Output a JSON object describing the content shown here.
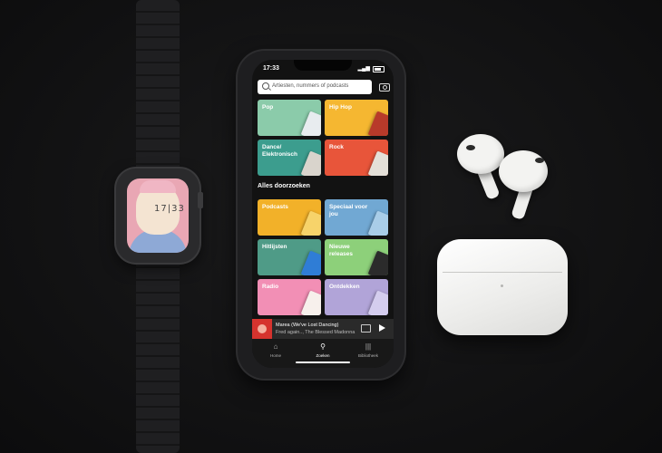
{
  "watch": {
    "time": "17|33"
  },
  "phone": {
    "status": {
      "time": "17:33"
    },
    "search": {
      "placeholder": "Artiesten, nummers of podcasts"
    },
    "top_genres": [
      {
        "label": "Pop",
        "color": "#8bcbaa"
      },
      {
        "label": "Hip Hop",
        "color": "#f5b731"
      },
      {
        "label": "Dance/ Elektronisch",
        "color": "#3c9d8e"
      },
      {
        "label": "Rock",
        "color": "#e8553a"
      }
    ],
    "section_heading": "Alles doorzoeken",
    "browse_all": [
      {
        "label": "Podcasts",
        "color": "#f2b129"
      },
      {
        "label": "Speciaal voor jou",
        "color": "#71a8d3"
      },
      {
        "label": "Hitlijsten",
        "color": "#4f9b87"
      },
      {
        "label": "Nieuwe releases",
        "color": "#8dd07a"
      },
      {
        "label": "Radio",
        "color": "#f28fb5"
      },
      {
        "label": "Ontdekken",
        "color": "#b1a4d8"
      }
    ],
    "mini_player": {
      "title": "Marea (We've Lost Dancing)",
      "artist": "Fred again.., The Blessed Madonna"
    },
    "tabs": [
      {
        "label": "Home",
        "icon": "home-icon"
      },
      {
        "label": "Zoeken",
        "icon": "search-icon"
      },
      {
        "label": "Bibliotheek",
        "icon": "library-icon"
      }
    ]
  }
}
